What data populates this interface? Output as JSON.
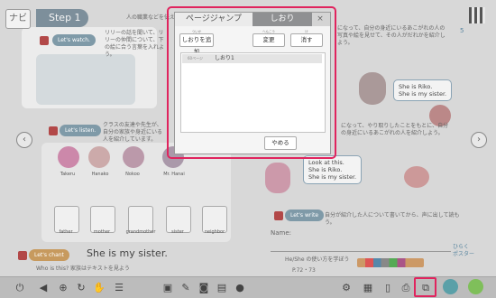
{
  "header": {
    "navi_label": "ナビ",
    "step_label": "Step 1",
    "top_text": "人の職業などを伝え",
    "right_badge": "5"
  },
  "textbook": {
    "lets_watch": "Let's watch.",
    "watch_desc": "リリーの話を聞いて、リリーの仲間について、下の絵に合う言葉を入れよう。",
    "top_right_text": "になって、自分の身近にいるあこがれの人の写真や絵を見せて、その人がだれかを紹介しよう。",
    "lets_listen": "Let's listen.",
    "listen_desc": "クラスの友達や先生が、自分の家族や身近にいる人を紹介しています。",
    "mid_right_text": "になって、やり取りしたことをもとに、自分の身近にいるあこがれの人を紹介しよう。",
    "bubble_top": "She is Riko.\nShe is my sister.",
    "bubble_mid": "Look at this.\nShe is Riko.\nShe is my sister.",
    "person_names": [
      "Takeru",
      "Hanako",
      "Nokoo",
      "Mr. Hanai"
    ],
    "family_labels": [
      "father",
      "mother",
      "grandmother",
      "sister",
      "neighbor"
    ],
    "lets_chant": "Let's chant",
    "chant_sentence": "She is my sister.",
    "chant_sub": "Who is this? 家族はテキストを見よう",
    "lets_write": "Let's write",
    "write_desc": "自分が紹介した人について書いてから、声に出して読もう。",
    "name_label": "Name:",
    "footer_text": "He/She の使い方を学ぼう",
    "page_hint": "P.72・73",
    "small_tag": "ひらく\nポスター"
  },
  "dialog": {
    "tab_page_jump": "ページジャンプ",
    "tab_bookmark": "しおり",
    "close_glyph": "×",
    "add_button": "しおりを追加",
    "add_ruby": "ついか",
    "edit_button": "変更",
    "edit_ruby": "へんこう",
    "delete_button": "消す",
    "delete_ruby": "け",
    "bookmarks": [
      {
        "page": "60ページ",
        "name": "しおり1"
      }
    ],
    "quit_button": "やめる"
  },
  "icons": [
    "power-icon",
    "back-icon",
    "zoom-icon",
    "refresh-icon",
    "hand-icon",
    "list-icon",
    "window-icon",
    "pen-icon",
    "camera-icon",
    "ruler-icon",
    "settings-icon",
    "grid-icon",
    "book-icon",
    "print-icon",
    "bookmark-icon",
    "book-view-icon",
    "check-icon"
  ],
  "colors": {
    "highlight": "#e0245e",
    "tab_active": "#8f9092",
    "pill": "#7f9aa8"
  }
}
